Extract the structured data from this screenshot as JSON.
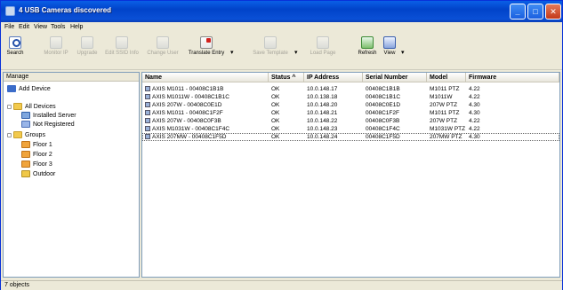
{
  "window": {
    "title": "4 USB Cameras discovered",
    "minimize": "_",
    "maximize": "□",
    "close": "✕"
  },
  "menu": [
    "File",
    "Edit",
    "View",
    "Tools",
    "Help"
  ],
  "toolbar": {
    "buttons": [
      {
        "label": "Search",
        "icon": "search-icon",
        "enabled": true
      },
      {
        "label": "Monitor IP",
        "icon": "monitor-icon",
        "enabled": false
      },
      {
        "label": "Upgrade",
        "icon": "upgrade-icon",
        "enabled": false
      },
      {
        "label": "Edit SSID Info",
        "icon": "edit-icon",
        "enabled": false
      },
      {
        "label": "Change User",
        "icon": "user-icon",
        "enabled": false
      },
      {
        "label": "Translate Entry",
        "icon": "translate-icon",
        "enabled": true
      },
      {
        "label": "Save Template",
        "icon": "save-template-icon",
        "enabled": false
      },
      {
        "label": "Load Page",
        "icon": "load-page-icon",
        "enabled": false
      },
      {
        "label": "Refresh",
        "icon": "refresh-icon",
        "enabled": true
      },
      {
        "label": "View",
        "icon": "view-icon",
        "enabled": true
      }
    ]
  },
  "left_pane": {
    "header": "Manage",
    "add_device": "Add Device",
    "tree": [
      {
        "label": "All Devices",
        "icon": "devices-icon",
        "level": 0,
        "expander": "-"
      },
      {
        "label": "Installed Server",
        "icon": "monitor-icon",
        "level": 1
      },
      {
        "label": "Not Registered",
        "icon": "network-icon",
        "level": 1
      },
      {
        "label": "Groups",
        "icon": "group-icon",
        "level": 0,
        "expander": "-"
      },
      {
        "label": "Floor 1",
        "icon": "floor-icon",
        "level": 1
      },
      {
        "label": "Floor 2",
        "icon": "floor-icon",
        "level": 1
      },
      {
        "label": "Floor 3",
        "icon": "floor-icon",
        "level": 1
      },
      {
        "label": "Outdoor",
        "icon": "outdoor-icon",
        "level": 1
      }
    ]
  },
  "table": {
    "columns": [
      "Name",
      "Status",
      "IP Address",
      "Serial Number",
      "Model",
      "Firmware"
    ],
    "sort_arrow": "^",
    "rows": [
      {
        "name": "AXIS M1011 - 00408C1B1B",
        "status": "OK",
        "ip": "10.0.148.17",
        "serial": "00408C1B1B",
        "model": "M1011 PTZ",
        "firmware": "4.22"
      },
      {
        "name": "AXIS M1011W - 00408C1B1C",
        "status": "OK",
        "ip": "10.0.138.18",
        "serial": "00408C1B1C",
        "model": "M1011W",
        "firmware": "4.22"
      },
      {
        "name": "AXIS 207W - 00408C0E1D",
        "status": "OK",
        "ip": "10.0.148.20",
        "serial": "00408C0E1D",
        "model": "207W PTZ",
        "firmware": "4.30"
      },
      {
        "name": "AXIS M1011 - 00408C1F2F",
        "status": "OK",
        "ip": "10.0.148.21",
        "serial": "00408C1F2F",
        "model": "M1011 PTZ",
        "firmware": "4.30"
      },
      {
        "name": "AXIS 207W - 00408C0F3B",
        "status": "OK",
        "ip": "10.0.148.22",
        "serial": "00408C0F3B",
        "model": "207W PTZ",
        "firmware": "4.22"
      },
      {
        "name": "AXIS M1031W - 00408C1F4C",
        "status": "OK",
        "ip": "10.0.148.23",
        "serial": "00408C1F4C",
        "model": "M1031W PTZ",
        "firmware": "4.22"
      },
      {
        "name": "AXIS 207MW - 00408C1F5D",
        "status": "OK",
        "ip": "10.0.148.24",
        "serial": "00408C1F5D",
        "model": "207MW PTZ",
        "firmware": "4.30"
      }
    ]
  },
  "status_bar": "7 objects"
}
